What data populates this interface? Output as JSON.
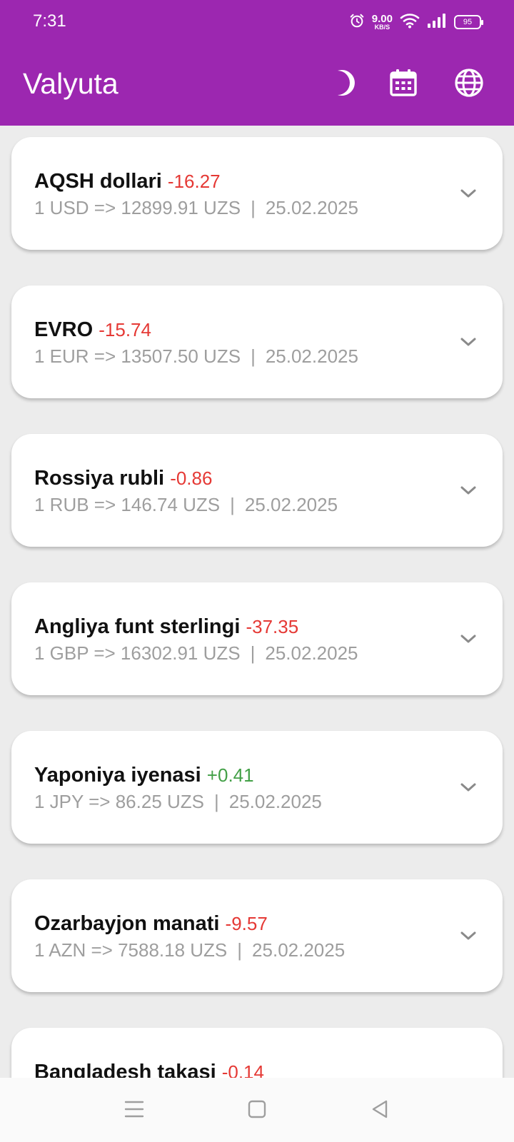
{
  "status_bar": {
    "time": "7:31",
    "net_speed_value": "9.00",
    "net_speed_unit": "KB/S",
    "battery": "95",
    "icons": [
      "alarm-icon",
      "wifi-icon",
      "signal-icon",
      "battery-icon"
    ]
  },
  "app_bar": {
    "title": "Valyuta",
    "actions": [
      "theme-moon-icon",
      "calendar-icon",
      "language-globe-icon"
    ]
  },
  "colors": {
    "primary": "#9c27b0",
    "negative": "#e53935",
    "positive": "#43a047"
  },
  "currencies": [
    {
      "name": "AQSH dollari",
      "change": "-16.27",
      "trend": "neg",
      "rate": "1 USD => 12899.91 UZS",
      "date": "25.02.2025"
    },
    {
      "name": "EVRO",
      "change": "-15.74",
      "trend": "neg",
      "rate": "1 EUR => 13507.50 UZS",
      "date": "25.02.2025"
    },
    {
      "name": "Rossiya rubli",
      "change": "-0.86",
      "trend": "neg",
      "rate": "1 RUB => 146.74 UZS",
      "date": "25.02.2025"
    },
    {
      "name": "Angliya funt sterlingi",
      "change": "-37.35",
      "trend": "neg",
      "rate": "1 GBP => 16302.91 UZS",
      "date": "25.02.2025"
    },
    {
      "name": "Yaponiya iyenasi",
      "change": "+0.41",
      "trend": "pos",
      "rate": "1 JPY => 86.25 UZS",
      "date": "25.02.2025"
    },
    {
      "name": "Ozarbayjon manati",
      "change": "-9.57",
      "trend": "neg",
      "rate": "1 AZN => 7588.18 UZS",
      "date": "25.02.2025"
    },
    {
      "name": "Bangladesh takasi",
      "change": "-0.14",
      "trend": "neg",
      "rate": "",
      "date": ""
    }
  ],
  "separator": "|",
  "nav_bar": [
    "menu-icon",
    "home-square-icon",
    "back-triangle-icon"
  ]
}
